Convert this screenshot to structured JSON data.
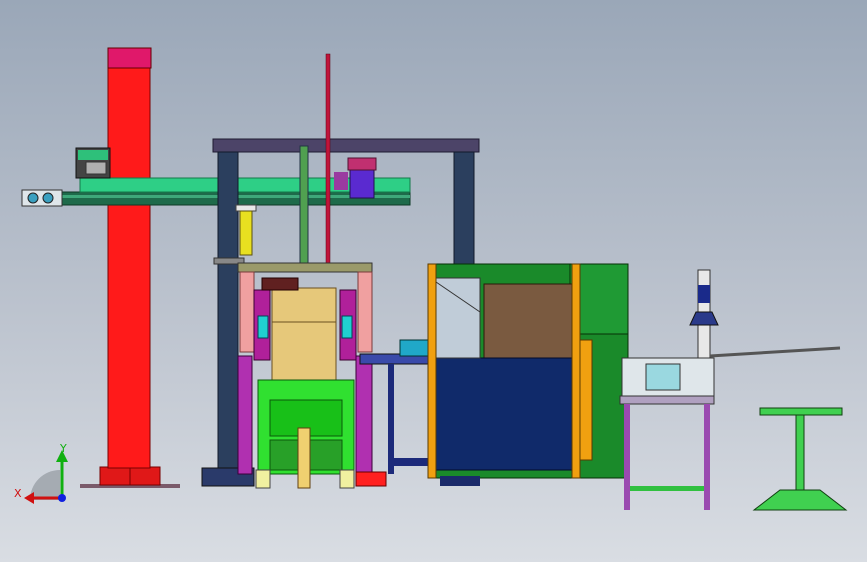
{
  "viewport": {
    "background_top": "#9aa7b8",
    "background_bottom": "#d9dde3"
  },
  "triad": {
    "x_label": "X",
    "y_label": "Y",
    "x_color": "#d01010",
    "y_color": "#10b010",
    "z_color": "#1020e0"
  },
  "colors": {
    "pillar_red": "#ff1a1a",
    "pillar_cap": "#e0186a",
    "rail_green": "#2ecf86",
    "frame_navy": "#2b3f5e",
    "beam_purple": "#4c4468",
    "magenta": "#b0209a",
    "pink": "#f0a0a0",
    "lime": "#30e030",
    "tan": "#e6c87a",
    "navy_panel": "#102a6a",
    "brown_panel": "#7a5a40",
    "dark_green": "#1a8a2a",
    "orange": "#f0a010",
    "table_green": "#40d050",
    "cyan": "#20c0d0"
  }
}
